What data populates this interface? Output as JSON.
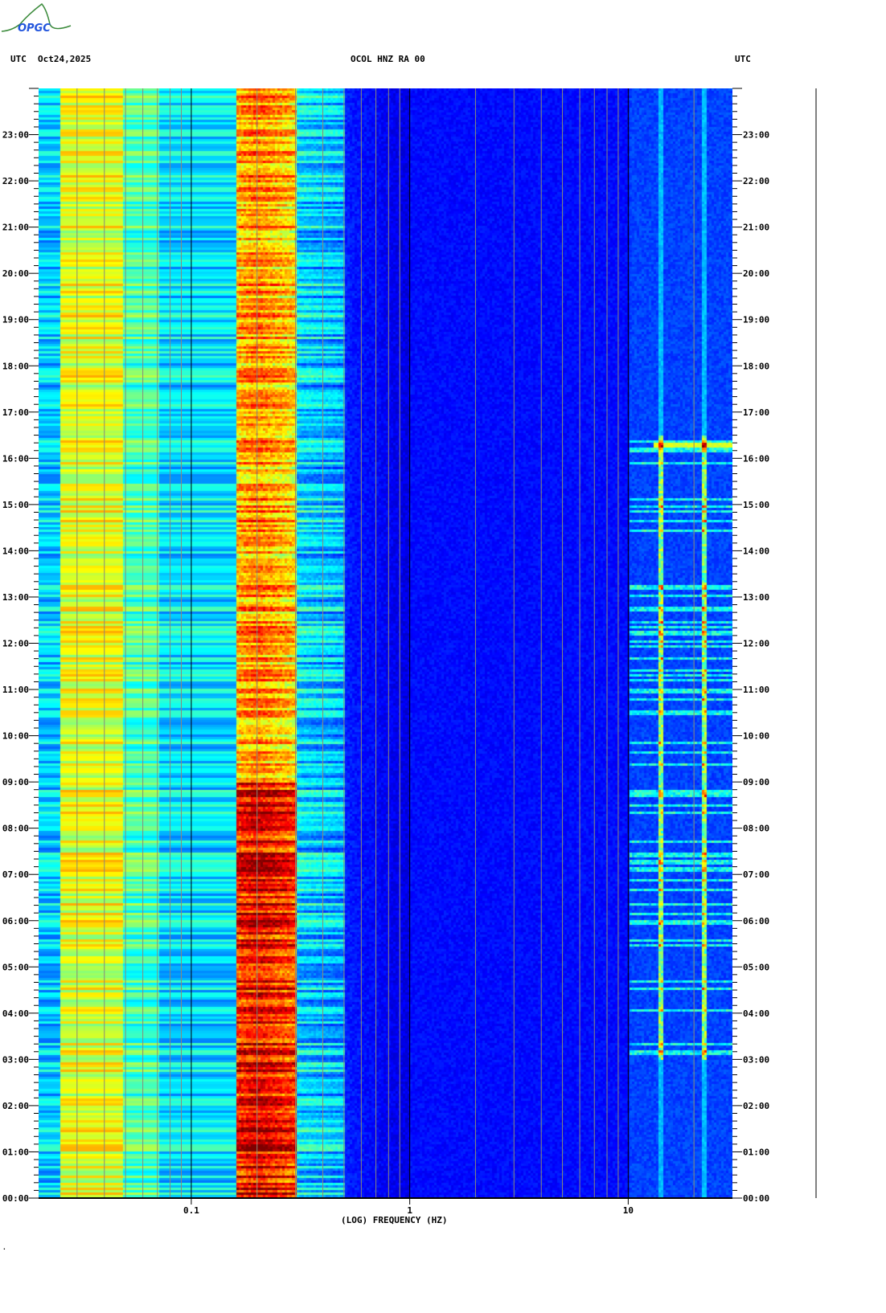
{
  "logo": {
    "text": "OPGC"
  },
  "header": {
    "left_tz": "UTC",
    "date": "Oct24,2025",
    "station": "OCOL HNZ RA 00",
    "right_tz": "UTC"
  },
  "footer": {
    "mark": "."
  },
  "chart_data": {
    "type": "heatmap",
    "title": "OCOL HNZ RA 00",
    "xlabel": "(LOG) FREQUENCY (HZ)",
    "ylabel": "UTC",
    "xscale": "log",
    "xlim": [
      0.02,
      30
    ],
    "ylim_hours": [
      0,
      24
    ],
    "x_ticks": [
      {
        "value": 0.1,
        "label": "0.1"
      },
      {
        "value": 1,
        "label": "1"
      },
      {
        "value": 10,
        "label": "10"
      }
    ],
    "y_tick_labels": [
      "00:00",
      "01:00",
      "02:00",
      "03:00",
      "04:00",
      "05:00",
      "06:00",
      "07:00",
      "08:00",
      "09:00",
      "10:00",
      "11:00",
      "12:00",
      "13:00",
      "14:00",
      "15:00",
      "16:00",
      "17:00",
      "18:00",
      "19:00",
      "20:00",
      "21:00",
      "22:00",
      "23:00"
    ],
    "minor_y_tick_minutes": 10,
    "colormap": "jet",
    "grid": "vertical gridlines at 1-9 x each decade",
    "band_profile": [
      {
        "f_min": 0.02,
        "f_max": 0.025,
        "level": 0.33
      },
      {
        "f_min": 0.025,
        "f_max": 0.048,
        "level": 0.6
      },
      {
        "f_min": 0.048,
        "f_max": 0.07,
        "level": 0.45
      },
      {
        "f_min": 0.07,
        "f_max": 0.16,
        "level": 0.35
      },
      {
        "f_min": 0.16,
        "f_max": 0.3,
        "level": 0.66
      },
      {
        "f_min": 0.3,
        "f_max": 0.5,
        "level": 0.32
      },
      {
        "f_min": 0.5,
        "f_max": 1,
        "level": 0.17
      },
      {
        "f_min": 1,
        "f_max": 10,
        "level": 0.11
      },
      {
        "f_min": 10,
        "f_max": 30,
        "level": 0.16
      }
    ],
    "microseism_peak_hz": 0.2,
    "microseism_strong_hours": [
      0,
      9
    ],
    "cultural_noise_lines_hz": [
      14,
      22
    ],
    "cultural_noise_active_hours": [
      3,
      16.5
    ]
  }
}
